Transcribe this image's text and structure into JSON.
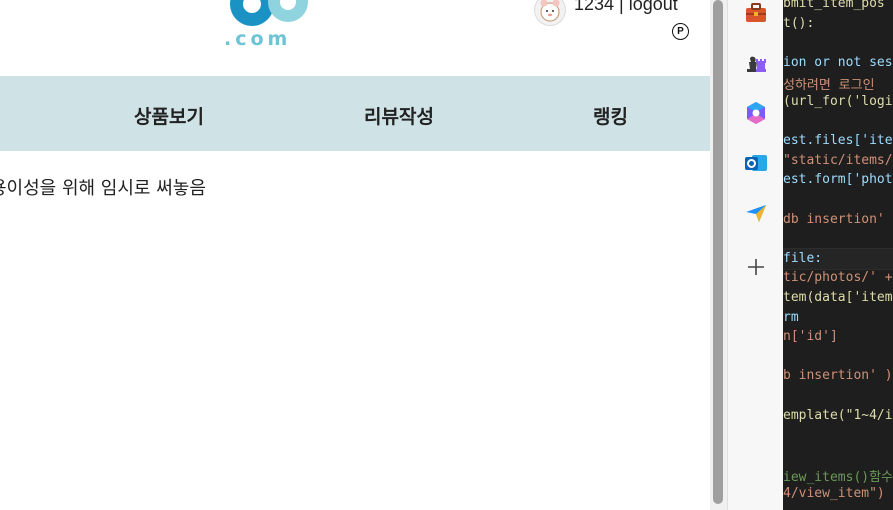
{
  "logo": {
    "text": ".com"
  },
  "user": {
    "name": "1234",
    "separator": " | ",
    "logout": "logout"
  },
  "badge": {
    "letter": "P"
  },
  "nav": {
    "items": [
      {
        "label": "상품보기"
      },
      {
        "label": "리뷰작성"
      },
      {
        "label": "랭킹"
      }
    ]
  },
  "notice": "용이성을 위해 임시로 써놓음",
  "sidebar": {
    "icons": [
      "toolbox-icon",
      "chess-icon",
      "copilot-icon",
      "outlook-icon",
      "send-icon",
      "add-icon"
    ]
  },
  "editor": {
    "lines": [
      {
        "text": "bmit_item_pos",
        "color": "#dcdcaa"
      },
      {
        "text": "t():",
        "color": "#dcdcaa"
      },
      {
        "text": "",
        "color": "#d4d4d4"
      },
      {
        "text": "ion or not ses",
        "color": "#9cdcfe"
      },
      {
        "text": "성하려면 로그인",
        "color": "#ce9178"
      },
      {
        "text": "(url_for('logi",
        "color": "#dcdcaa"
      },
      {
        "text": "",
        "color": "#d4d4d4"
      },
      {
        "text": "est.files['item",
        "color": "#9cdcfe"
      },
      {
        "text": "\"static/items/",
        "color": "#ce9178"
      },
      {
        "text": "est.form['phot",
        "color": "#9cdcfe"
      },
      {
        "text": "",
        "color": "#d4d4d4"
      },
      {
        "text": "db insertion'",
        "color": "#ce9178"
      },
      {
        "text": "",
        "color": "#d4d4d4"
      },
      {
        "text": "file:",
        "color": "#9cdcfe"
      },
      {
        "text": "tic/photos/' +",
        "color": "#ce9178"
      },
      {
        "text": "tem(data['item",
        "color": "#dcdcaa"
      },
      {
        "text": "rm",
        "color": "#9cdcfe"
      },
      {
        "text": "n['id']",
        "color": "#ce9178"
      },
      {
        "text": "",
        "color": "#d4d4d4"
      },
      {
        "text": "b insertion' )",
        "color": "#ce9178"
      },
      {
        "text": "",
        "color": "#d4d4d4"
      },
      {
        "text": "emplate(\"1~4/i",
        "color": "#dcdcaa"
      },
      {
        "text": "",
        "color": "#d4d4d4"
      },
      {
        "text": "",
        "color": "#d4d4d4"
      },
      {
        "text": "iew_items()함수",
        "color": "#6a9955"
      },
      {
        "text": "4/view_item\")",
        "color": "#ce9178"
      }
    ]
  },
  "colors": {
    "navbar": "#cfe2e5",
    "logo_primary": "#1a93c4",
    "logo_light": "#6cc4d6",
    "editor_bg": "#1e1e1e"
  }
}
